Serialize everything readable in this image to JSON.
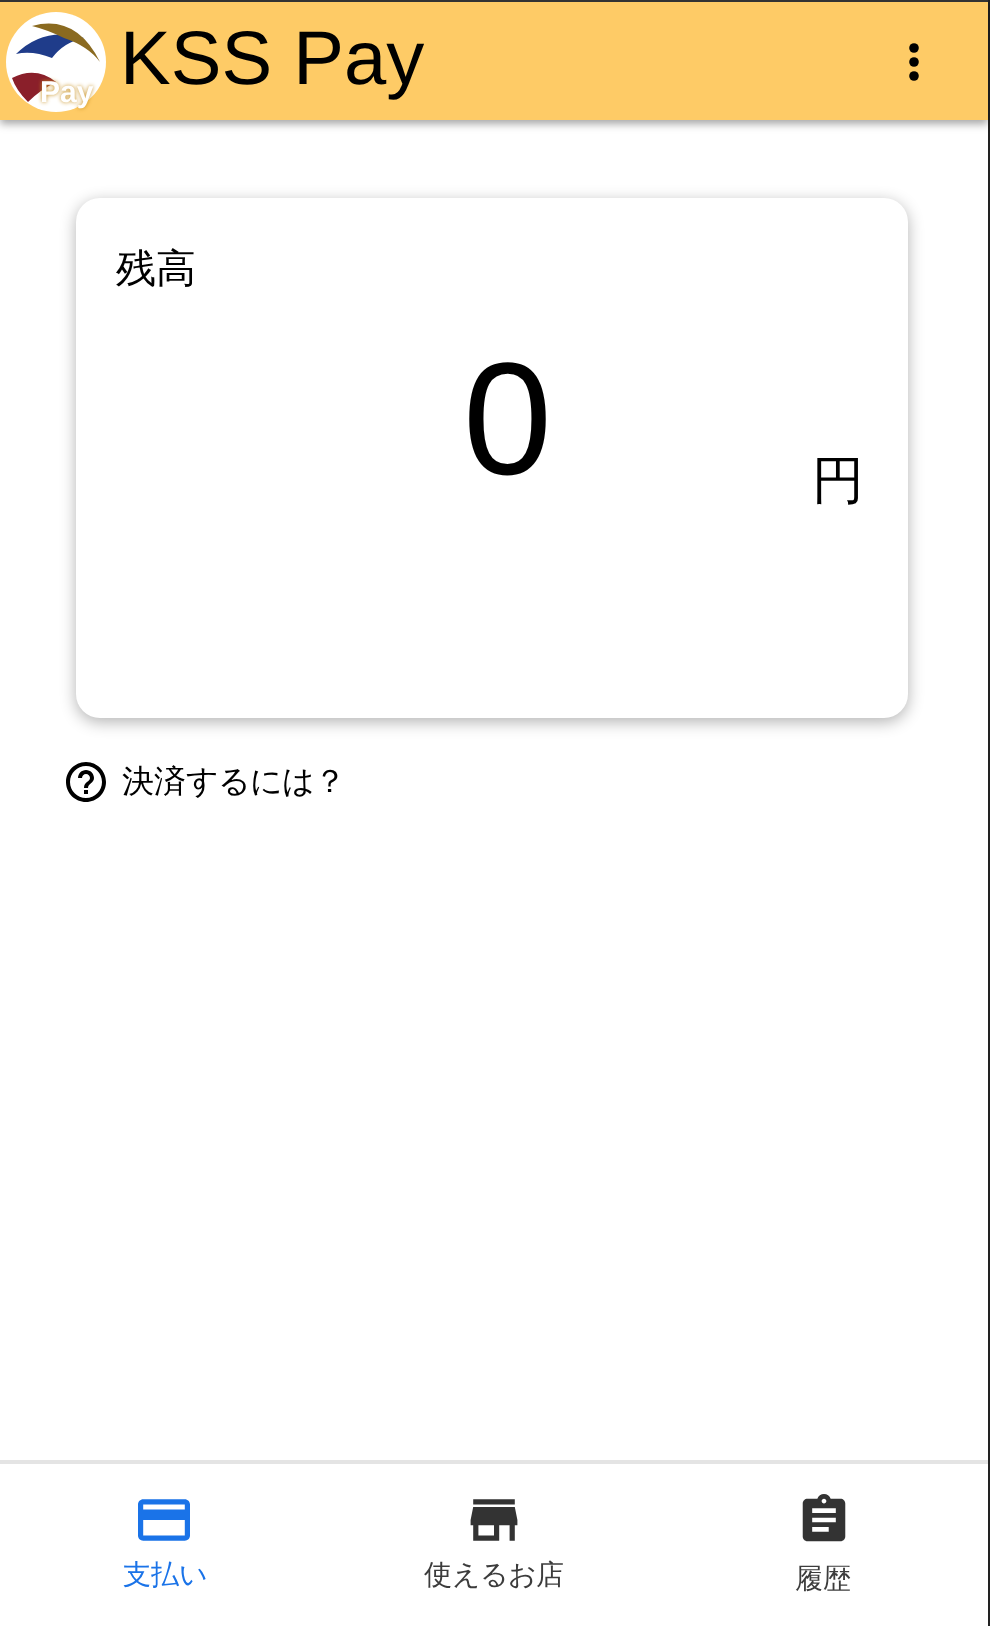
{
  "app_bar": {
    "logo_text": "Pay",
    "title": "KSS Pay"
  },
  "balance_card": {
    "label": "残高",
    "amount": "0",
    "unit": "円"
  },
  "help_link": {
    "label": "決済するには？"
  },
  "bottom_nav": [
    {
      "kind": "card",
      "label": "支払い",
      "selected": true
    },
    {
      "kind": "store",
      "label": "使えるお店",
      "selected": false
    },
    {
      "kind": "clipboard",
      "label": "履歴",
      "selected": false
    }
  ]
}
